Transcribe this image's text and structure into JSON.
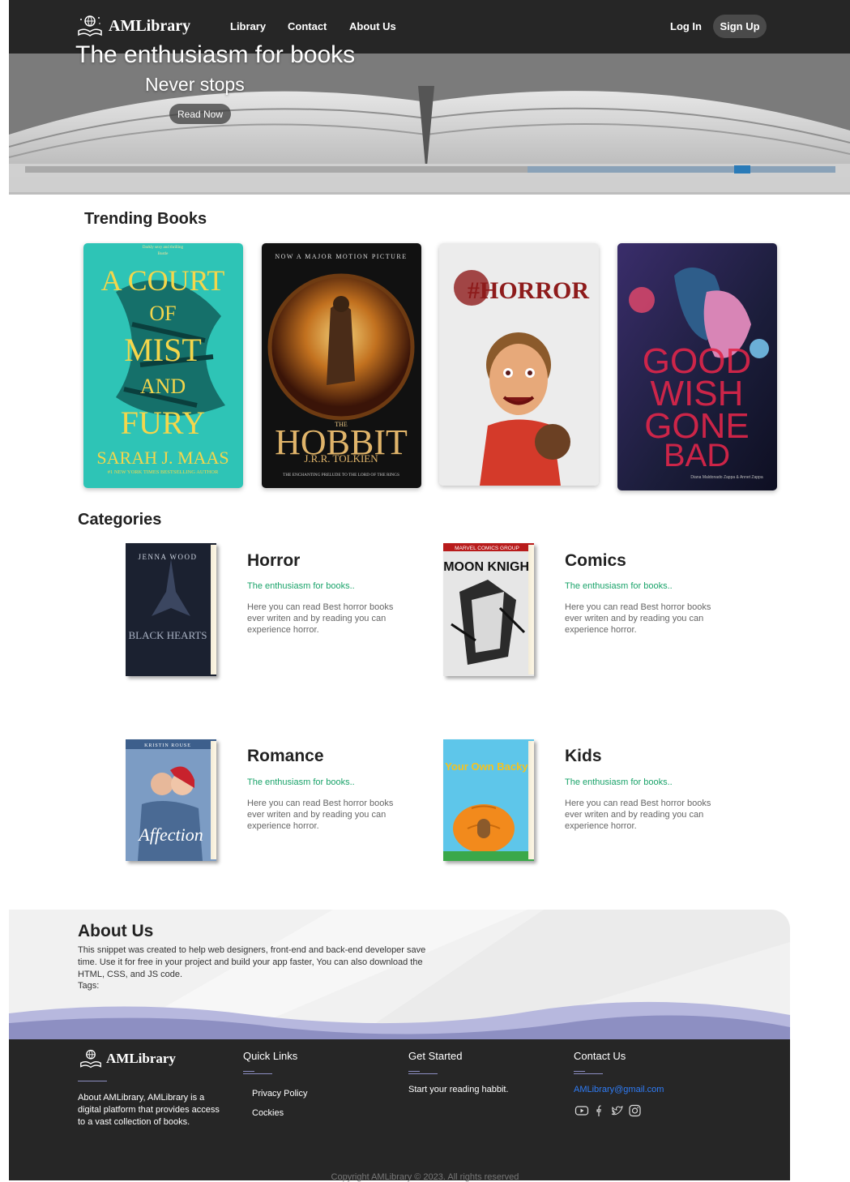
{
  "brand": {
    "name": "AMLibrary"
  },
  "nav": {
    "links": [
      "Library",
      "Contact",
      "About Us"
    ],
    "login": "Log In",
    "signup": "Sign Up"
  },
  "hero": {
    "title": "The enthusiasm for books",
    "subtitle": "Never stops",
    "button": "Read Now"
  },
  "trending": {
    "title": "Trending Books",
    "books": [
      {
        "cover_top": "Darkly sexy and thrilling",
        "cover_top2": "Bustle",
        "title_lines": [
          "A COURT",
          "OF",
          "MIST",
          "AND",
          "FURY"
        ],
        "author": "SARAH J. MAAS",
        "tagline": "#1 NEW YORK TIMES BESTSELLING AUTHOR",
        "color": "#2ec4b6"
      },
      {
        "cover_top": "NOW A MAJOR MOTION PICTURE",
        "title": "HOBBIT",
        "title_small": "THE",
        "author": "J.R.R. TOLKIEN",
        "tagline": "THE ENCHANTING PRELUDE TO THE LORD OF THE RINGS",
        "color": "#1a1a1a"
      },
      {
        "title": "#HORROR",
        "color": "#e8e8e8"
      },
      {
        "title_lines": [
          "GOOD",
          "WISH",
          "GONE",
          "BAD"
        ],
        "author": "Diana Maldonado Zappa & Annet Zappa",
        "color": "#1b1d3a"
      }
    ]
  },
  "categories": {
    "title": "Categories",
    "items": [
      {
        "name": "Horror",
        "tag": "The enthusiasm for books..",
        "desc": "Here you can read Best horror books ever writen and by reading you can experience horror.",
        "cover_author": "JENNA WOOD",
        "cover_title": "BLACK HEARTS"
      },
      {
        "name": "Comics",
        "tag": "The enthusiasm for books..",
        "desc": "Here you can read Best horror books ever writen and by reading you can experience horror.",
        "cover_author": "MARVEL COMICS GROUP",
        "cover_title": "MOON KNIGHT"
      },
      {
        "name": "Romance",
        "tag": "The enthusiasm for books..",
        "desc": "Here you can read Best horror books ever writen and by reading you can experience horror.",
        "cover_author": "KRISTIN ROUSE",
        "cover_title": "Affection"
      },
      {
        "name": "Kids",
        "tag": "The enthusiasm for books..",
        "desc": "Here you can read Best horror books ever writen and by reading you can experience horror.",
        "cover_author": "",
        "cover_title": "In Your Own Backyard"
      }
    ]
  },
  "about": {
    "title": "About Us",
    "text": "This snippet was created to help web designers, front-end and back-end developer save time. Use it for free in your project and build your app faster, You can also download the HTML, CSS, and JS code.",
    "tags": "Tags:"
  },
  "footer": {
    "about": "About AMLibrary, AMLibrary is a digital platform that provides access to a vast collection of books.",
    "quick_links": {
      "title": "Quick Links",
      "items": [
        "Privacy Policy",
        "Cockies"
      ]
    },
    "get_started": {
      "title": "Get Started",
      "text": "Start your reading habbit."
    },
    "contact": {
      "title": "Contact Us",
      "email": "AMLibrary@gmail.com"
    },
    "social": [
      "youtube-icon",
      "facebook-icon",
      "twitter-icon",
      "instagram-icon"
    ],
    "copyright": "Copyright AMLibrary © 2023. All rights reserved"
  },
  "colors": {
    "nav_bg": "#262626",
    "accent_green": "#1aa36a",
    "wave": "#8d8fc2",
    "link_blue": "#2f7cf6"
  }
}
